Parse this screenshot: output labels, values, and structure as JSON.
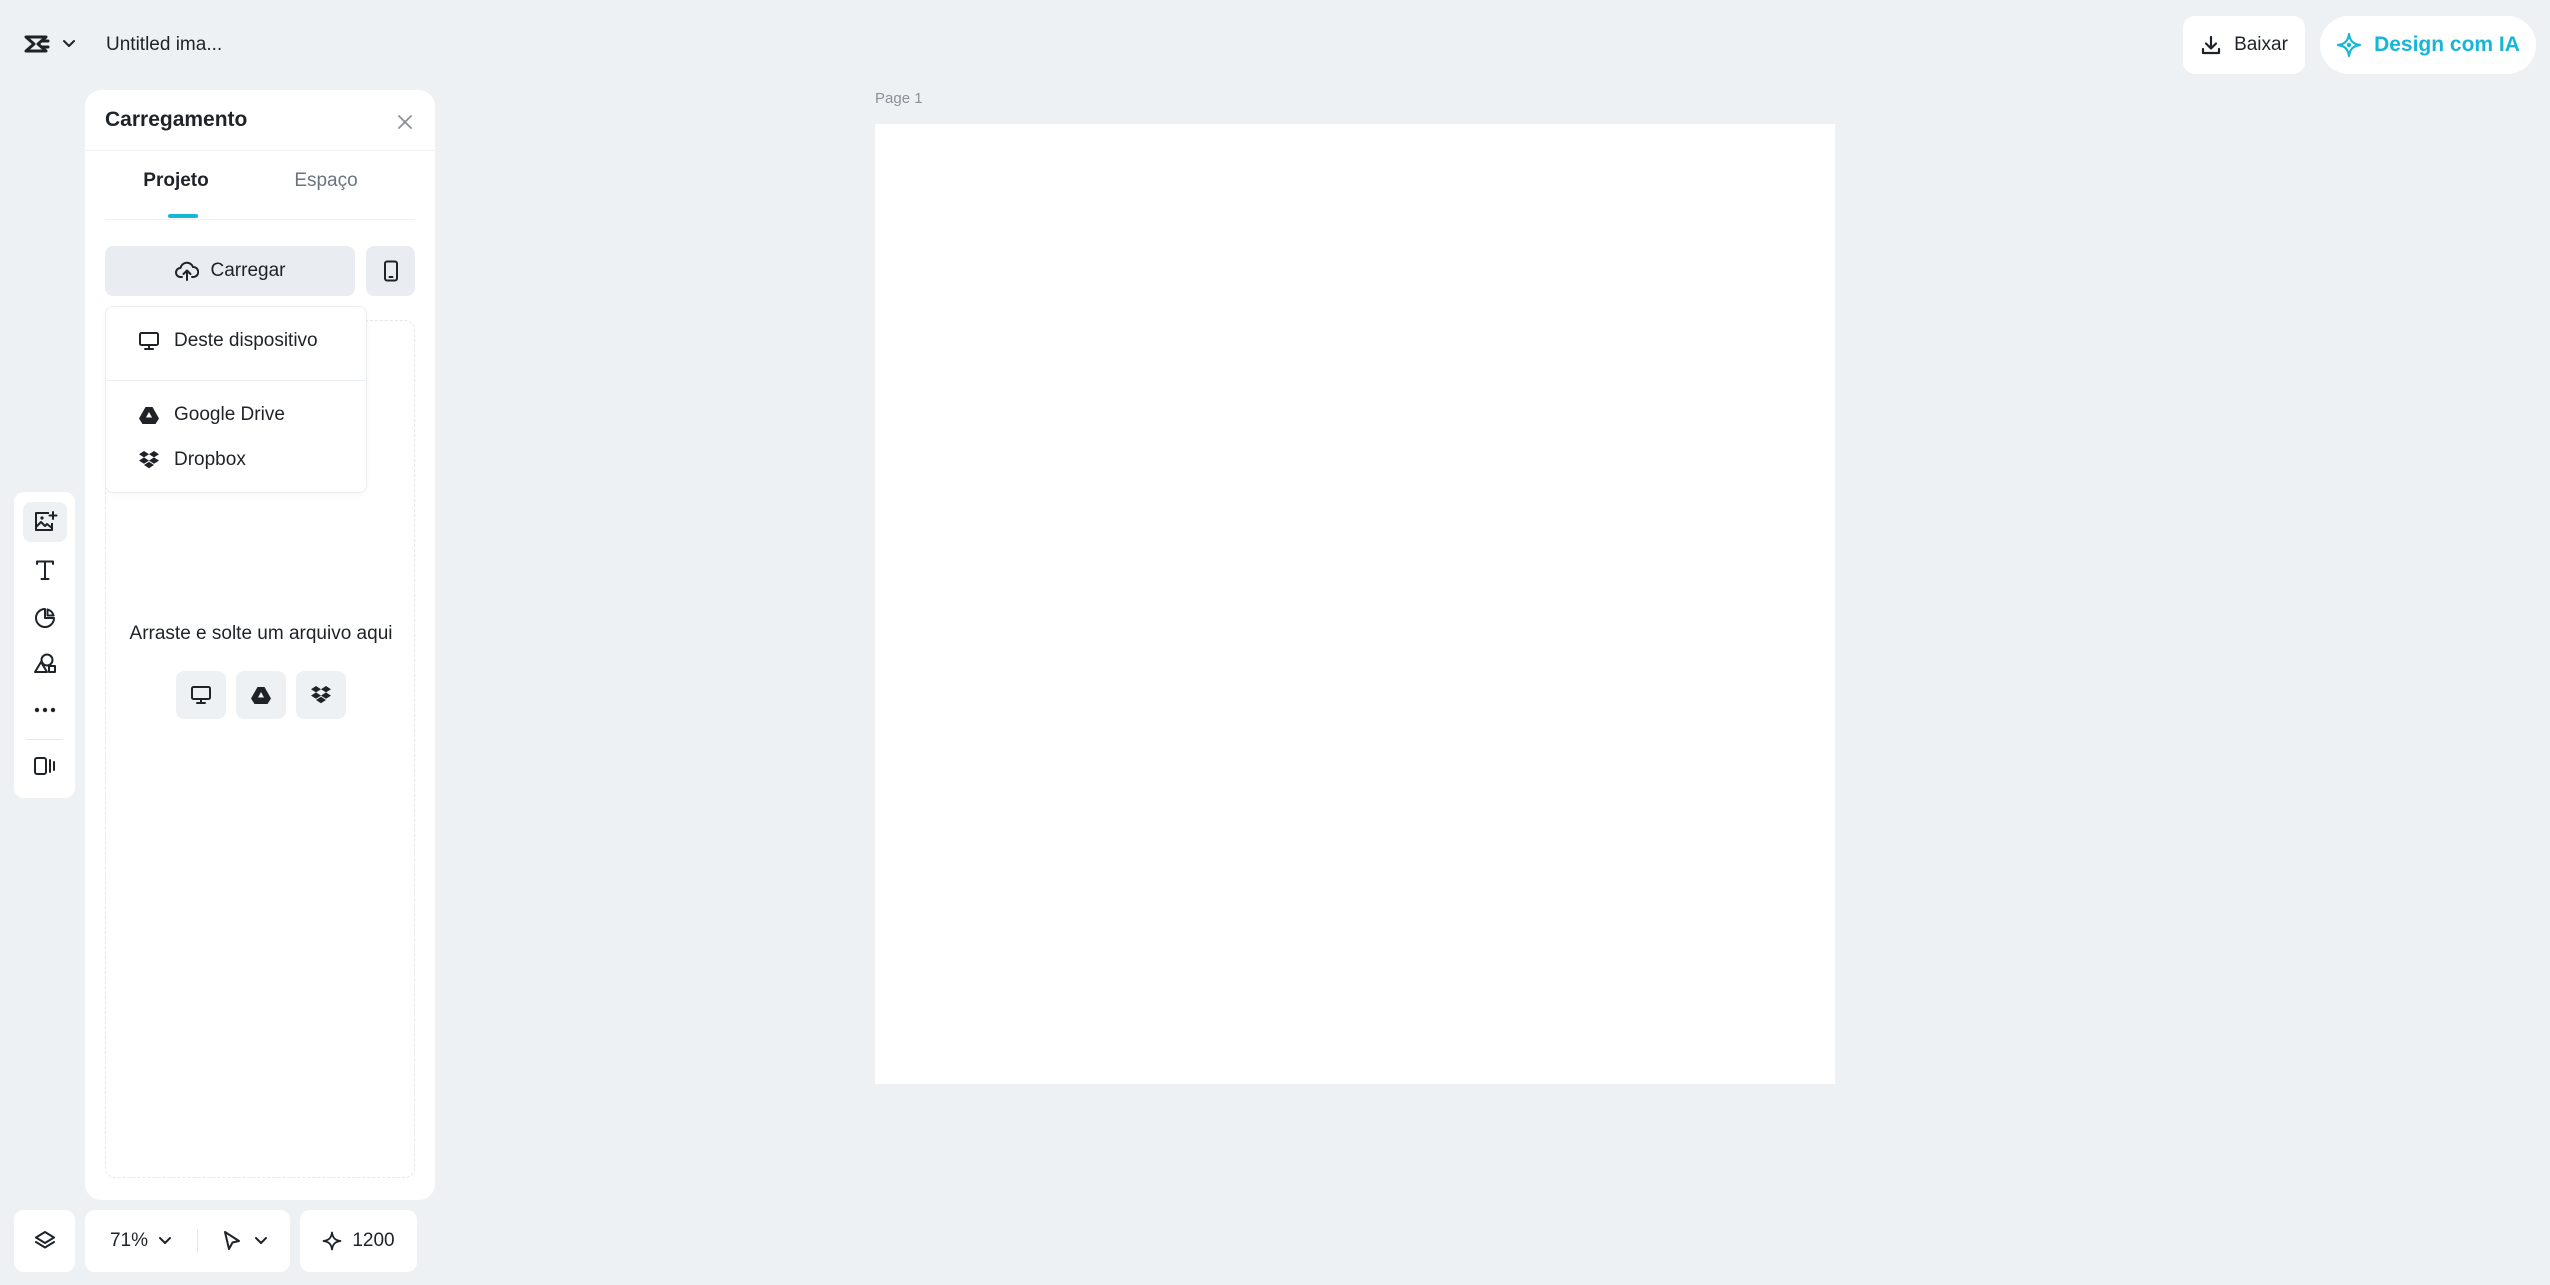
{
  "header": {
    "doc_title": "Untitled ima...",
    "download_label": "Baixar",
    "ai_label": "Design com IA",
    "accent_color": "#16b7d6"
  },
  "toolbar": {
    "tools": [
      "upload-image-icon",
      "text-icon",
      "element-icon",
      "shapes-icon",
      "more-icon",
      "brand-kit-icon"
    ]
  },
  "panel": {
    "title": "Carregamento",
    "tabs": [
      {
        "label": "Projeto",
        "active": true
      },
      {
        "label": "Espaço",
        "active": false
      }
    ],
    "upload_label": "Carregar",
    "drop_text": "Arraste e solte um arquivo aqui",
    "drop_sources": [
      "desktop-icon",
      "google-drive-icon",
      "dropbox-icon"
    ]
  },
  "upload_menu": {
    "items": [
      {
        "label": "Deste dispositivo",
        "icon": "desktop-icon"
      },
      {
        "label": "Google Drive",
        "icon": "google-drive-icon"
      },
      {
        "label": "Dropbox",
        "icon": "dropbox-icon"
      }
    ]
  },
  "canvas": {
    "page_label": "Page 1",
    "background": "#ffffff"
  },
  "bottom_bar": {
    "zoom": "71%",
    "credits": "1200"
  }
}
